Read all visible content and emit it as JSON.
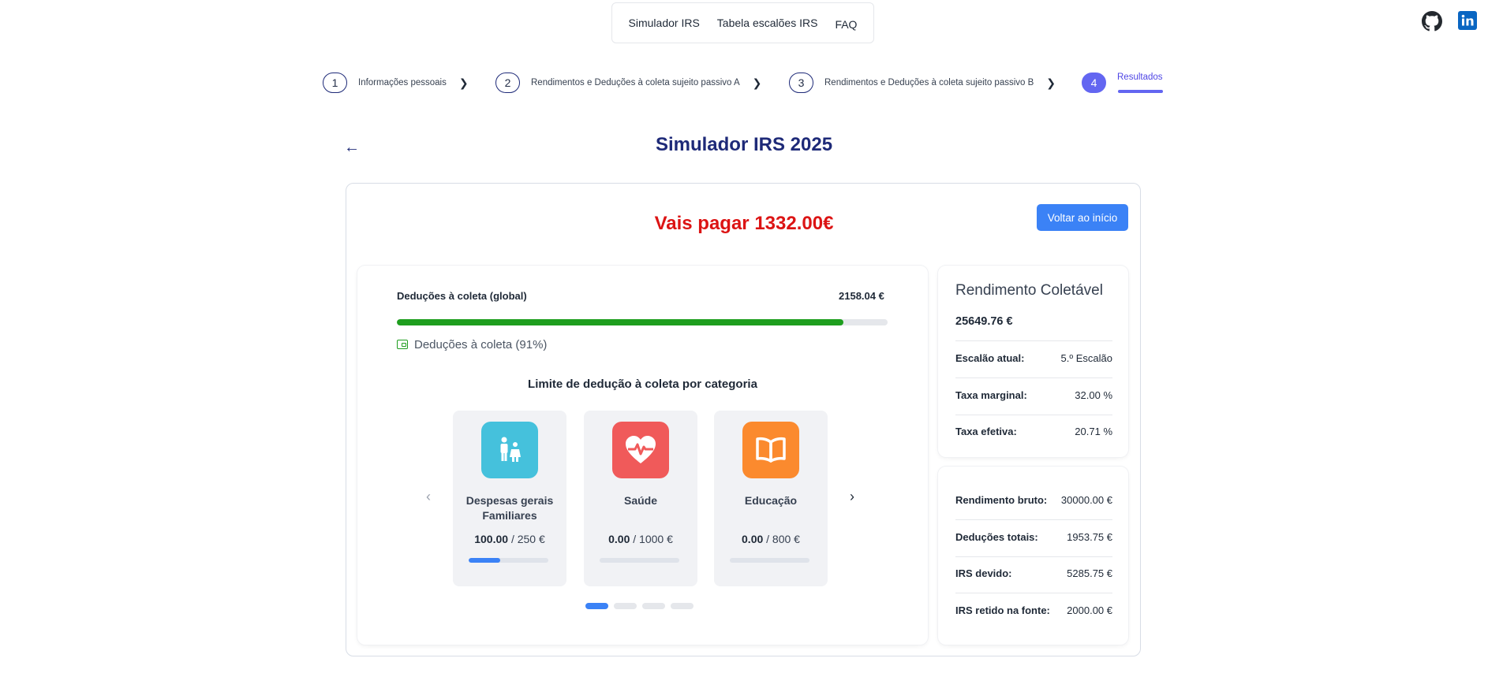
{
  "topnav": {
    "items": [
      "Simulador IRS",
      "Tabela escalões IRS",
      "FAQ"
    ]
  },
  "social": {
    "github_icon": "github-icon",
    "linkedin_icon": "linkedin-icon"
  },
  "stepper": {
    "steps": [
      {
        "num": "1",
        "label": "Informações pessoais"
      },
      {
        "num": "2",
        "label": "Rendimentos e Deduções à coleta sujeito passivo A"
      },
      {
        "num": "3",
        "label": "Rendimentos e Deduções à coleta sujeito passivo B"
      },
      {
        "num": "4",
        "label": "Resultados"
      }
    ],
    "active_step": 4
  },
  "page": {
    "title": "Simulador IRS 2025"
  },
  "result": {
    "pay_text": "Vais pagar 1332.00€",
    "back_button": "Voltar ao início"
  },
  "deductions": {
    "label": "Deduções à coleta (global)",
    "value": "2158.04 €",
    "percent": 91,
    "legend": "Deduções à coleta (91%)"
  },
  "categories": {
    "title": "Limite de dedução à coleta por categoria",
    "items": [
      {
        "name": "Despesas gerais Familiares",
        "used": "100.00",
        "limit": "/ 250 €",
        "fraction": 0.4,
        "color": "#45c1dc",
        "icon": "family-icon"
      },
      {
        "name": "Saúde",
        "used": "0.00",
        "limit": "/ 1000 €",
        "fraction": 0.0,
        "color": "#f05a5a",
        "icon": "heart-pulse-icon"
      },
      {
        "name": "Educação",
        "used": "0.00",
        "limit": "/ 800 €",
        "fraction": 0.0,
        "color": "#fb8a2e",
        "icon": "book-icon"
      }
    ],
    "pages": 4,
    "active_page": 1
  },
  "summary": {
    "title": "Rendimento Coletável",
    "value": "25649.76 €",
    "rows": [
      {
        "label": "Escalão atual:",
        "value": "5.º Escalão"
      },
      {
        "label": "Taxa marginal:",
        "value": "32.00 %"
      },
      {
        "label": "Taxa efetiva:",
        "value": "20.71 %"
      }
    ]
  },
  "totals": {
    "rows": [
      {
        "label": "Rendimento bruto:",
        "value": "30000.00 €"
      },
      {
        "label": "Deduções totais:",
        "value": "1953.75 €"
      },
      {
        "label": "IRS devido:",
        "value": "5285.75 €"
      },
      {
        "label": "IRS retido na fonte:",
        "value": "2000.00 €"
      }
    ]
  },
  "colors": {
    "accent": "#3b82f6",
    "primary": "#1e2a78",
    "step_active": "#6366f1",
    "pay": "#dc1414",
    "progress": "#1e9e1e"
  }
}
